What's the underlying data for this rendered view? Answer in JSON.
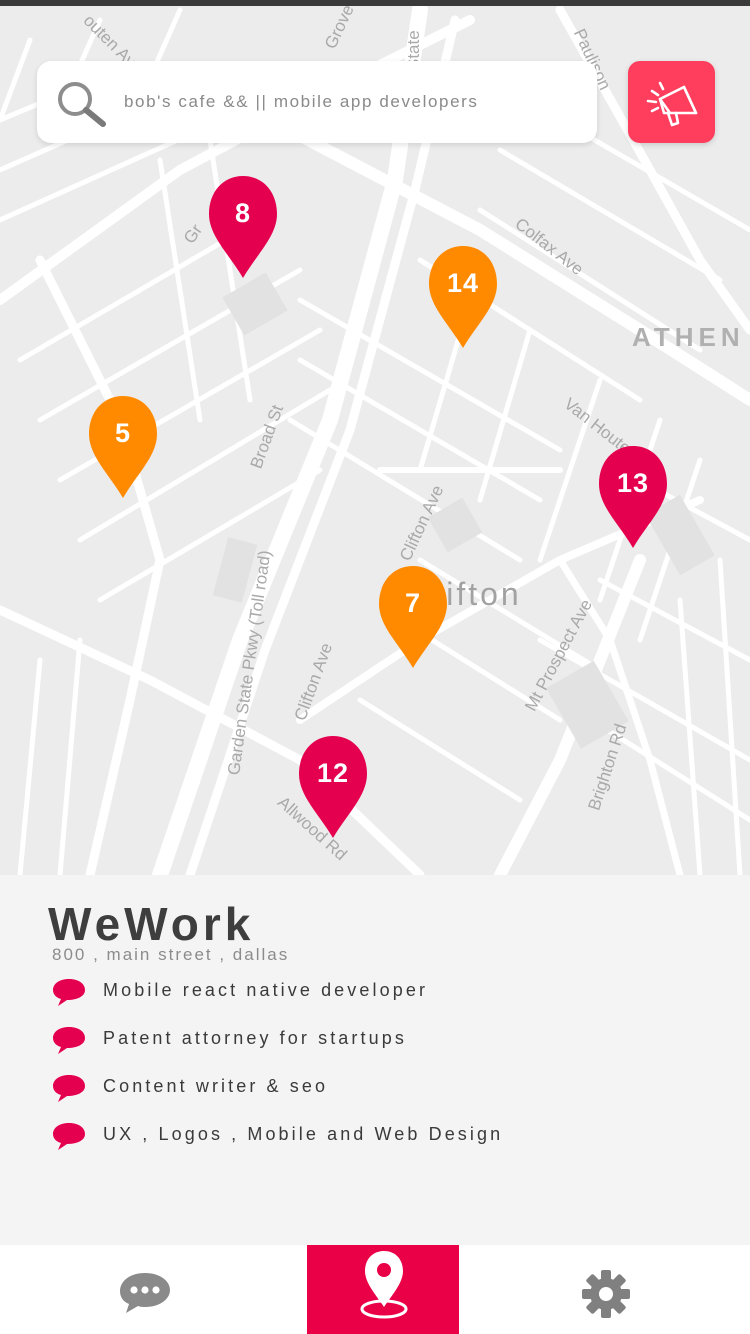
{
  "search": {
    "query": "bob's cafe && || mobile app developers"
  },
  "map": {
    "street_labels": {
      "gouten_ave": "outen Ave",
      "grove": "Grove",
      "state": "State",
      "paulison": "Paulison",
      "colfax": "Colfax Ave",
      "athen": "ATHEN",
      "van_houten": "Van Houten Ave",
      "broad": "Broad St",
      "gsp": "Garden State Pkwy (Toll road)",
      "clifton_ave_1": "Clifton Ave",
      "clifton_ave_2": "Clifton Ave",
      "clifton": "Clifton",
      "mt_prospect": "Mt Prospect Ave",
      "brighton": "Brighton Rd",
      "allwood": "Allwood Rd",
      "gr": "Gr"
    },
    "pins": [
      {
        "number": "8",
        "color": "#e5004f"
      },
      {
        "number": "14",
        "color": "#ff8a00"
      },
      {
        "number": "5",
        "color": "#ff8a00"
      },
      {
        "number": "13",
        "color": "#e5004f"
      },
      {
        "number": "7",
        "color": "#ff8a00"
      },
      {
        "number": "12",
        "color": "#e5004f"
      }
    ]
  },
  "place": {
    "name": "WeWork",
    "address": "800 , main street , dallas",
    "services": [
      "Mobile react native developer",
      "Patent attorney for startups",
      "Content writer  & seo",
      "UX , Logos , Mobile and Web Design"
    ]
  },
  "tabs": {
    "chat_icon": "chat-bubble-icon",
    "map_icon": "location-pin-icon",
    "settings_icon": "gear-icon",
    "active": "map"
  },
  "colors": {
    "accent": "#ea0047",
    "orange": "#ff8a00",
    "announce": "#ff3d5d"
  }
}
